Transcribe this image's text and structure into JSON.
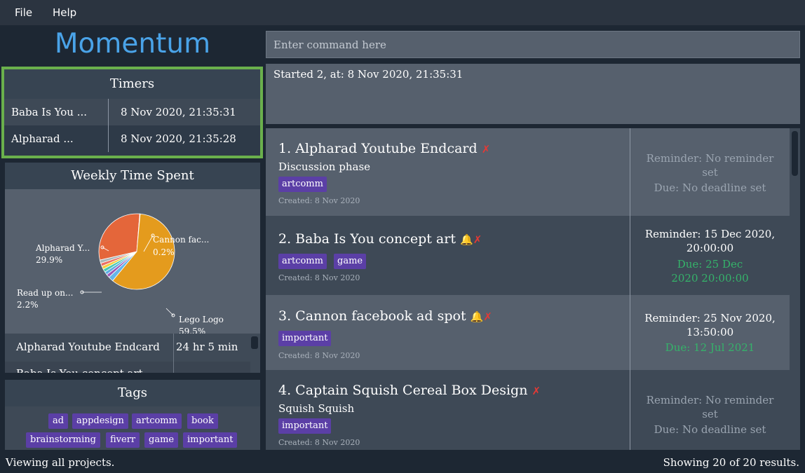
{
  "menu": {
    "file": "File",
    "help": "Help"
  },
  "app_title": "Momentum",
  "command": {
    "placeholder": "Enter command here"
  },
  "result": "Started 2, at: 8 Nov 2020, 21:35:31",
  "timers": {
    "header": "Timers",
    "rows": [
      {
        "name": "Baba Is You ...",
        "time": "8 Nov 2020, 21:35:31"
      },
      {
        "name": "Alpharad ...",
        "time": "8 Nov 2020, 21:35:28"
      }
    ]
  },
  "weekly": {
    "header": "Weekly Time Spent",
    "chart_data": {
      "type": "pie",
      "title": "",
      "slices": [
        {
          "label": "Lego Logo",
          "value": 59.5,
          "color": "#e49b1d"
        },
        {
          "label": "Alpharad Y...",
          "value": 29.9,
          "color": "#e4663a"
        },
        {
          "label": "Read up on...",
          "value": 2.2,
          "color": "#64b5ea"
        },
        {
          "label": "Cannon fac...",
          "value": 0.2,
          "color": "#c0c0c0"
        }
      ],
      "label_texts": {
        "alpharad_name": "Alpharad Y...",
        "alpharad_pct": "29.9%",
        "cannon_name": "Cannon fac...",
        "cannon_pct": "0.2%",
        "read_name": "Read up on...",
        "read_pct": "2.2%",
        "lego_name": "Lego Logo",
        "lego_pct": "59.5%"
      }
    },
    "table": [
      {
        "name": "Alpharad Youtube Endcard",
        "duration": "24 hr 5 min"
      },
      {
        "name": "Baba Is You concept art",
        "duration": ""
      }
    ]
  },
  "tags": {
    "header": "Tags",
    "items": [
      "ad",
      "appdesign",
      "artcomm",
      "book",
      "brainstorming",
      "fiverr",
      "game",
      "important"
    ]
  },
  "projects": [
    {
      "title": "1. Alpharad Youtube Endcard",
      "description": "Discussion phase",
      "tags": [
        "artcomm"
      ],
      "created": "Created: 8 Nov 2020",
      "reminder": "Reminder: No reminder set",
      "due": "Due: No deadline set"
    },
    {
      "title": "2. Baba Is You concept art",
      "description": "",
      "tags": [
        "artcomm",
        "game"
      ],
      "created": "Created: 8 Nov 2020",
      "reminder": "Reminder: 15 Dec 2020, 20:00:00",
      "due": "Due: 25 Dec 2020 20:00:00"
    },
    {
      "title": "3. Cannon facebook ad spot",
      "description": "",
      "tags": [
        "important"
      ],
      "created": "Created: 8 Nov 2020",
      "reminder": "Reminder: 25 Nov 2020, 13:50:00",
      "due": "Due: 12 Jul 2021"
    },
    {
      "title": "4. Captain Squish Cereal Box Design",
      "description": "Squish Squish",
      "tags": [
        "important"
      ],
      "created": "Created: 8 Nov 2020",
      "reminder": "Reminder: No reminder set",
      "due": "Due: No deadline set"
    }
  ],
  "status": {
    "left": "Viewing all projects.",
    "right": "Showing 20 of 20 results."
  },
  "colors": {
    "accent": "#4aa3e8",
    "tag": "#5b3fa6",
    "timer_border": "#6ab04c",
    "due_green": "#35b36a",
    "cross_red": "#e53935"
  }
}
